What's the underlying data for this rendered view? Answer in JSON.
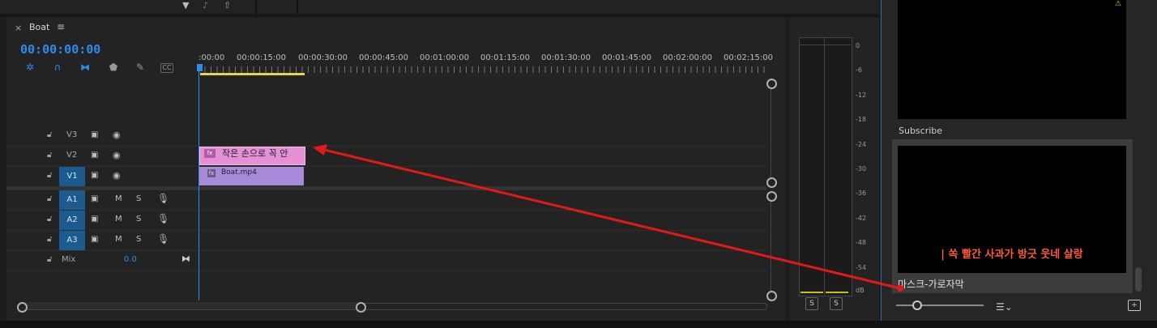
{
  "sequence": {
    "close_glyph": "×",
    "name": "Boat",
    "menu_glyph": "≡",
    "timecode": "00:00:00:00"
  },
  "tools": [
    "snap-icon",
    "magnet-icon",
    "linked-selection-icon",
    "marker-icon",
    "wrench-icon",
    "captions-icon"
  ],
  "ruler": {
    "labels": [
      ":00:00",
      "00:00:15:00",
      "00:00:30:00",
      "00:00:45:00",
      "00:01:00:00",
      "00:01:15:00",
      "00:01:30:00",
      "00:01:45:00",
      "00:02:00:00",
      "00:02:15:00"
    ]
  },
  "tracks": {
    "video": [
      {
        "name": "V3",
        "selected": false
      },
      {
        "name": "V2",
        "selected": false
      },
      {
        "name": "V1",
        "selected": true
      }
    ],
    "audio": [
      {
        "name": "A1",
        "m": "M",
        "s": "S"
      },
      {
        "name": "A2",
        "m": "M",
        "s": "S"
      },
      {
        "name": "A3",
        "m": "M",
        "s": "S"
      }
    ],
    "mix": {
      "label": "Mix",
      "value": "0.0"
    }
  },
  "clips": {
    "text_clip_label": "작은 손으로 꼭 안",
    "video_clip_label": "Boat.mp4",
    "fx_badge": "fx"
  },
  "meter": {
    "db_labels": [
      "0",
      "-6",
      "-12",
      "-18",
      "-24",
      "-30",
      "-36",
      "-42",
      "-48",
      "-54",
      "dB"
    ],
    "solo_left": "S",
    "solo_right": "S",
    "floor_color": "#c9c200"
  },
  "project_panel": {
    "item1_label": "Subscribe",
    "item2_subtitle": "| 쏙 빨간 사과가 방긋 웃네 살랑",
    "item2_label": "마스크-가로자막",
    "warn_glyph": "⚠"
  },
  "colors": {
    "accent": "#2d8ceb",
    "annotation_arrow": "#e01a1a",
    "text_clip": "#e58fd6",
    "video_clip": "#a78ad8"
  }
}
